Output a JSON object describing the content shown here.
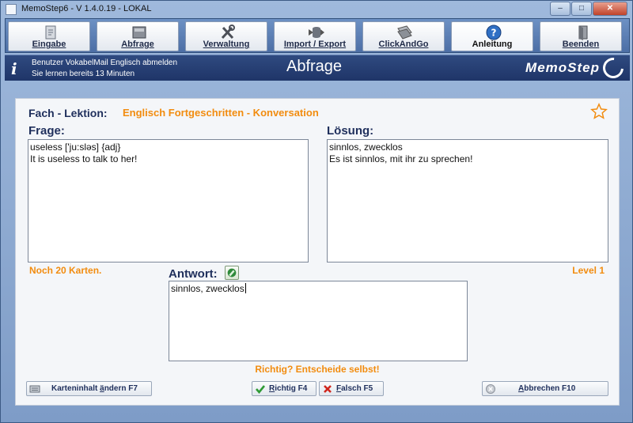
{
  "window": {
    "title": "MemoStep6 - V 1.4.0.19  -  LOKAL",
    "controls": {
      "minimize": "–",
      "maximize": "□",
      "close": "✕"
    }
  },
  "toolbar": {
    "items": [
      {
        "label": "Eingabe",
        "icon": "notepad-icon"
      },
      {
        "label": "Abfrage",
        "icon": "card-stack-icon"
      },
      {
        "label": "Verwaltung",
        "icon": "tools-icon"
      },
      {
        "label": "Import / Export",
        "icon": "database-transfer-icon"
      },
      {
        "label": "ClickAndGo",
        "icon": "click-and-go-icon"
      },
      {
        "label": "Anleitung",
        "icon": "help-icon"
      },
      {
        "label": "Beenden",
        "icon": "exit-door-icon"
      }
    ],
    "help_glyph": "?"
  },
  "header": {
    "info_glyph": "i",
    "line1": "Benutzer VokabelMail Englisch abmelden",
    "line2": "Sie lernen bereits 13 Minuten",
    "page_title": "Abfrage",
    "logo_text": "MemoStep"
  },
  "lesson": {
    "label": "Fach - Lektion:",
    "value": "Englisch Fortgeschritten - Konversation"
  },
  "frage": {
    "label": "Frage:",
    "line1": "useless ['ju:sləs] {adj}",
    "line2": "It is useless to talk to her!"
  },
  "loesung": {
    "label": "Lösung:",
    "line1": "sinnlos, zwecklos",
    "line2": "Es ist sinnlos, mit ihr zu sprechen!"
  },
  "antwort": {
    "label": "Antwort:",
    "value": "sinnlos, zwecklos"
  },
  "status": {
    "remaining": "Noch 20 Karten.",
    "level": "Level 1",
    "hint": "Richtig? Entscheide selbst!"
  },
  "buttons": {
    "edit_pre": "Karteninhalt ",
    "edit_ul": "ä",
    "edit_post": "ndern  F7",
    "richtig_ul": "R",
    "richtig_post": "ichtig  F4",
    "falsch_ul": "F",
    "falsch_post": "alsch  F5",
    "abbrechen_ul": "A",
    "abbrechen_post": "bbrechen  F10"
  },
  "colors": {
    "accent_orange": "#f28c0f",
    "header_blue": "#1f3568",
    "label_navy": "#1f2f5c"
  }
}
